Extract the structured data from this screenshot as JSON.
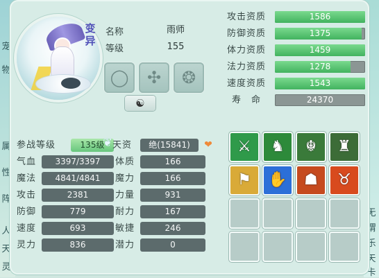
{
  "pet": {
    "badge": "变异",
    "name_label": "名称",
    "name_value": "雨师",
    "level_label": "等级",
    "level_value": "155"
  },
  "equipment_slots": [
    {
      "icon": "ring-collar-icon"
    },
    {
      "icon": "armor-icon"
    },
    {
      "icon": "amulet-icon"
    }
  ],
  "yinyang_button": {
    "icon": "yin-yang-icon",
    "glyph": "☯"
  },
  "aptitudes": [
    {
      "label": "攻击资质",
      "value": "1586",
      "fill": 1.0
    },
    {
      "label": "防御资质",
      "value": "1375",
      "fill": 0.96
    },
    {
      "label": "体力资质",
      "value": "1459",
      "fill": 1.0
    },
    {
      "label": "法力资质",
      "value": "1278",
      "fill": 0.84
    },
    {
      "label": "速度资质",
      "value": "1543",
      "fill": 1.0
    },
    {
      "label": "寿　命",
      "value": "24370",
      "fill": 0.0
    }
  ],
  "stats": {
    "battle_level_label": "参战等级",
    "battle_level_value": "135级",
    "talent_label": "天资",
    "talent_value": "绝(15841)",
    "left": [
      {
        "label": "气血",
        "value": "3397/3397"
      },
      {
        "label": "魔法",
        "value": "4841/4841"
      },
      {
        "label": "攻击",
        "value": "2381"
      },
      {
        "label": "防御",
        "value": "779"
      },
      {
        "label": "速度",
        "value": "693"
      },
      {
        "label": "灵力",
        "value": "836"
      }
    ],
    "right": [
      {
        "label": "体质",
        "value": "166"
      },
      {
        "label": "魔力",
        "value": "166"
      },
      {
        "label": "力量",
        "value": "931"
      },
      {
        "label": "耐力",
        "value": "167"
      },
      {
        "label": "敏捷",
        "value": "246"
      },
      {
        "label": "潜力",
        "value": "0"
      }
    ]
  },
  "skills": [
    {
      "icon": "sword-skill-icon",
      "bg": "#2f9a4a"
    },
    {
      "icon": "frog-skill-icon",
      "bg": "#2d8a3a"
    },
    {
      "icon": "warrior-skill-icon",
      "bg": "#3a7a3a"
    },
    {
      "icon": "shadow-skill-icon",
      "bg": "#3c6c37"
    },
    {
      "icon": "boot-skill-icon",
      "bg": "#d9aa38"
    },
    {
      "icon": "claw-skill-icon",
      "bg": "#2c6fd8"
    },
    {
      "icon": "strength-skill-icon",
      "bg": "#c64a1e"
    },
    {
      "icon": "beast-skill-icon",
      "bg": "#d84a1e"
    }
  ],
  "edge_left": [
    "宠",
    "物",
    "属",
    "性",
    "阵",
    "人",
    "天",
    "灵"
  ],
  "edge_right": [
    "无",
    "谓",
    "乐",
    "天",
    "卡"
  ]
}
